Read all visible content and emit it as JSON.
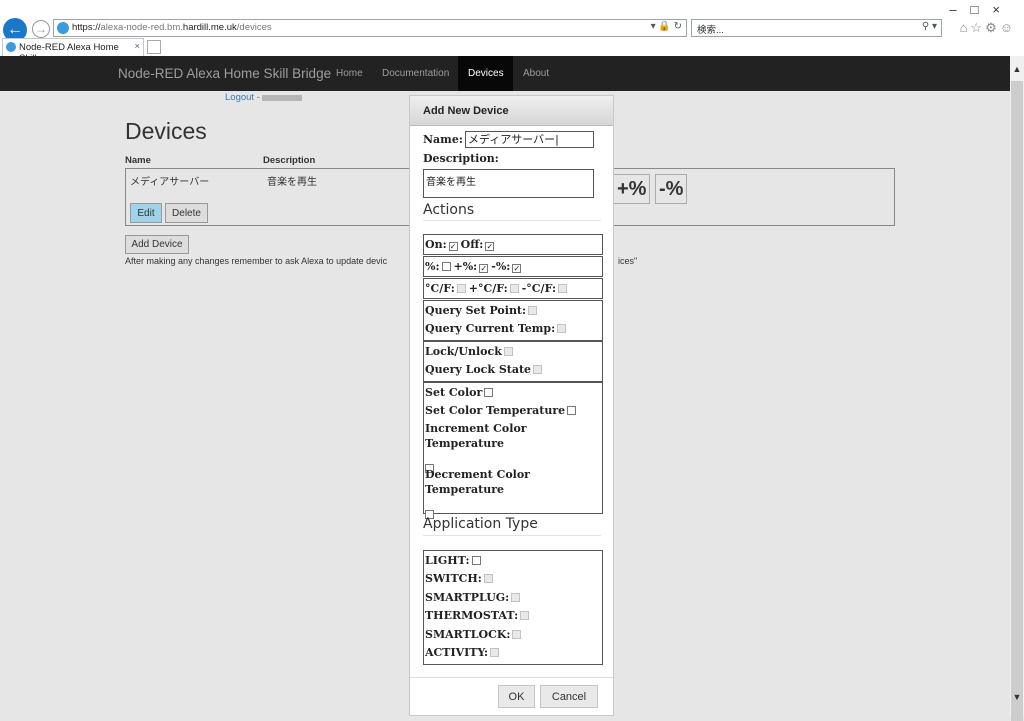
{
  "browser": {
    "url_prefix": "https://",
    "url_sub": "alexa-node-red.bm.",
    "url_host": "hardill.me.uk",
    "url_path": "/devices",
    "addr_icons": "▾ 🔒 ↻",
    "search_placeholder": "検索...",
    "search_icon": "⚲ ▾",
    "tab_title": "Node-RED Alexa Home Skill...",
    "tab_close": "×",
    "window_controls": "–□×",
    "tool_icons": "⌂☆⚙☺"
  },
  "navbar": {
    "brand": "Node-RED Alexa Home Skill Bridge",
    "items": [
      "Home",
      "Documentation",
      "Devices",
      "About"
    ]
  },
  "page": {
    "logout": "Logout -",
    "heading": "Devices",
    "col_name": "Name",
    "col_description": "Description",
    "device_name": "メディアサーバー",
    "device_description": "音楽を再生",
    "edit": "Edit",
    "delete": "Delete",
    "plus_pct": "+%",
    "minus_pct": "-%",
    "add_device": "Add Device",
    "note": "After making any changes remember to ask Alexa to update devic",
    "note_end": "ices\""
  },
  "dialog": {
    "title": "Add New Device",
    "name_label": "Name:",
    "name_value": "メディアサーバー|",
    "description_label": "Description:",
    "description_value": "音楽を再生",
    "actions_heading": "Actions",
    "on": "On:",
    "off": "Off:",
    "pct": "%:",
    "plus_pct": "+%:",
    "minus_pct": "-%:",
    "temp": "°C/F:",
    "plus_temp": "+°C/F:",
    "minus_temp": "-°C/F:",
    "query_set_point": "Query Set Point:",
    "query_current_temp": "Query Current Temp:",
    "lock_unlock": "Lock/Unlock",
    "query_lock_state": "Query Lock State",
    "set_color": "Set Color",
    "set_color_temp": "Set Color Temperature",
    "inc_color_temp_1": "Increment Color",
    "inc_color_temp_2": "Temperature",
    "dec_color_temp_1": "Decrement Color",
    "dec_color_temp_2": "Temperature",
    "app_type_heading": "Application Type",
    "light": "LIGHT:",
    "switch": "SWITCH:",
    "smartplug": "SMARTPLUG:",
    "thermostat": "THERMOSTAT:",
    "smartlock": "SMARTLOCK:",
    "activity": "ACTIVITY:",
    "ok": "OK",
    "cancel": "Cancel",
    "check_mark": "✓"
  },
  "scrollbar": {
    "up": "▲",
    "down": "▼"
  }
}
